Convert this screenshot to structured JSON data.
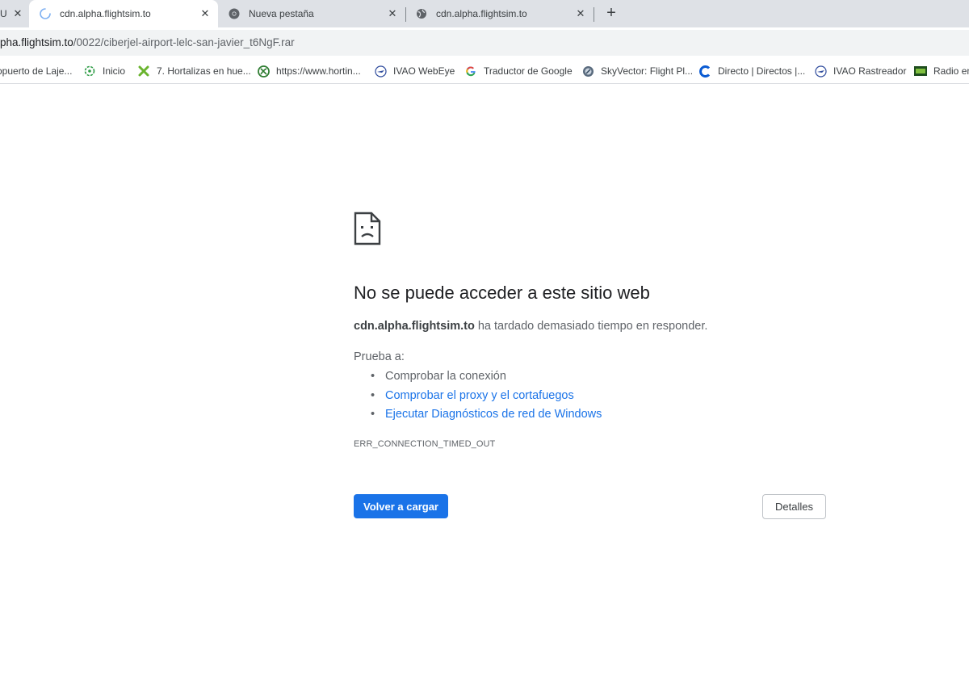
{
  "tabs": [
    {
      "title": "cdn.alpha.flightsim.to",
      "state": "loading",
      "icon": "loading-spinner-icon"
    },
    {
      "title": "Nueva pestaña",
      "icon": "chrome-icon"
    },
    {
      "title": "cdn.alpha.flightsim.to",
      "icon": "globe-icon"
    }
  ],
  "first_tab_fragment": "U",
  "new_tab_label": "+",
  "close_glyph": "✕",
  "address": {
    "host": "pha.flightsim.to",
    "path": "/0022/ciberjel-airport-lelc-san-javier_t6NgF.rar"
  },
  "bookmarks": [
    {
      "label": "opuerto de Laje...",
      "icon": "partial-icon"
    },
    {
      "label": "Inicio",
      "icon": "green-ring-icon"
    },
    {
      "label": "7. Hortalizas en hue...",
      "icon": "leaf-icon"
    },
    {
      "label": "https://www.hortin...",
      "icon": "green-globe-icon"
    },
    {
      "label": "IVAO WebEye",
      "icon": "ivao-icon"
    },
    {
      "label": "Traductor de Google",
      "icon": "google-icon"
    },
    {
      "label": "SkyVector: Flight Pl...",
      "icon": "skyvector-icon"
    },
    {
      "label": "Directo | Directos |...",
      "icon": "directo-icon"
    },
    {
      "label": "IVAO Rastreador",
      "icon": "ivao-icon"
    },
    {
      "label": "Radio en",
      "icon": "radio-icon"
    }
  ],
  "error": {
    "title": "No se puede acceder a este sitio web",
    "host": "cdn.alpha.flightsim.to",
    "message": " ha tardado demasiado tiempo en responder.",
    "try_label": "Prueba a:",
    "suggestions": [
      {
        "text": "Comprobar la conexión",
        "link": false
      },
      {
        "text": "Comprobar el proxy y el cortafuegos",
        "link": true
      },
      {
        "text": "Ejecutar Diagnósticos de red de Windows",
        "link": true
      }
    ],
    "code": "ERR_CONNECTION_TIMED_OUT",
    "reload_button": "Volver a cargar",
    "details_button": "Detalles"
  },
  "colors": {
    "accent": "#1a73e8",
    "tabstrip": "#dee1e6",
    "omnibox": "#f1f3f4"
  }
}
